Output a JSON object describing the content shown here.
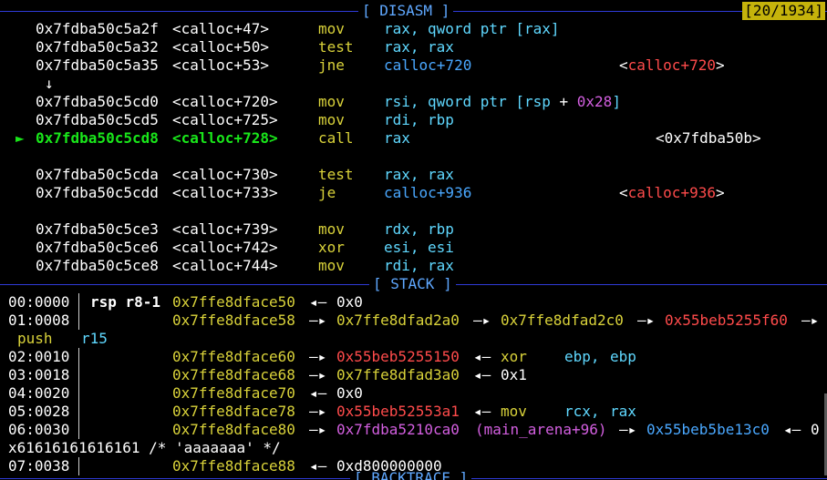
{
  "disasm": {
    "header": "[ DISASM ]",
    "counter": "[20/1934]",
    "rows": [
      {
        "addr": "0x7fdba50c5a2f",
        "sym": "<calloc+47>",
        "op": "mov",
        "a1": "rax,",
        "a2": "qword ptr [rax]",
        "target": ""
      },
      {
        "addr": "0x7fdba50c5a32",
        "sym": "<calloc+50>",
        "op": "test",
        "a1": "rax,",
        "a2": "rax",
        "target": ""
      },
      {
        "addr": "0x7fdba50c5a35",
        "sym": "<calloc+53>",
        "op": "jne",
        "a1": "calloc+720",
        "a2": "",
        "target": "<calloc+720>"
      },
      {
        "addr": "0x7fdba50c5cd0",
        "sym": "<calloc+720>",
        "op": "mov",
        "a1": "rsi,",
        "a2": "qword ptr [rsp + 0x28]",
        "target": ""
      },
      {
        "addr": "0x7fdba50c5cd5",
        "sym": "<calloc+725>",
        "op": "mov",
        "a1": "rdi,",
        "a2": "rbp",
        "target": ""
      },
      {
        "addr": "0x7fdba50c5cd8",
        "sym": "<calloc+728>",
        "op": "call",
        "a1": "rax",
        "a2": "",
        "target": "<0x7fdba50b>"
      },
      {
        "addr": "0x7fdba50c5cda",
        "sym": "<calloc+730>",
        "op": "test",
        "a1": "rax,",
        "a2": "rax",
        "target": ""
      },
      {
        "addr": "0x7fdba50c5cdd",
        "sym": "<calloc+733>",
        "op": "je",
        "a1": "calloc+936",
        "a2": "",
        "target": "<calloc+936>"
      },
      {
        "addr": "0x7fdba50c5ce3",
        "sym": "<calloc+739>",
        "op": "mov",
        "a1": "rdx,",
        "a2": "rbp",
        "target": ""
      },
      {
        "addr": "0x7fdba50c5ce6",
        "sym": "<calloc+742>",
        "op": "xor",
        "a1": "esi,",
        "a2": "esi",
        "target": ""
      },
      {
        "addr": "0x7fdba50c5ce8",
        "sym": "<calloc+744>",
        "op": "mov",
        "a1": "rdi,",
        "a2": "rax",
        "target": ""
      }
    ],
    "jump_arrow": "↓",
    "current_marker": "►",
    "target_prefix": "<",
    "target_sym": "calloc+720",
    "target_suffix": ">"
  },
  "stack": {
    "header": "[ STACK ]",
    "rows": [
      {
        "idx": "00:0000",
        "regs": "rsp r8-1",
        "addr": "0x7ffe8dface50"
      },
      {
        "idx": "01:0008",
        "regs": "",
        "addr": "0x7ffe8dface58"
      },
      {
        "idx": "02:0010",
        "regs": "",
        "addr": "0x7ffe8dface60"
      },
      {
        "idx": "03:0018",
        "regs": "",
        "addr": "0x7ffe8dface68"
      },
      {
        "idx": "04:0020",
        "regs": "",
        "addr": "0x7ffe8dface70"
      },
      {
        "idx": "05:0028",
        "regs": "",
        "addr": "0x7ffe8dface78"
      },
      {
        "idx": "06:0030",
        "regs": "",
        "addr": "0x7ffe8dface80"
      },
      {
        "idx": "07:0038",
        "regs": "",
        "addr": "0x7ffe8dface88"
      }
    ],
    "values": {
      "r0_val": "0x0",
      "r1_p1": "0x7ffe8dfad2a0",
      "r1_p2": "0x7ffe8dfad2c0",
      "r1_p3": "0x55beb5255f60",
      "r1_wrap_op": "push",
      "r1_wrap_arg": "r15",
      "r2_p1": "0x55beb5255150",
      "r2_op": "xor",
      "r2_a1": "ebp,",
      "r2_a2": "ebp",
      "r3_p1": "0x7ffe8dfad3a0",
      "r3_val": "0x1",
      "r4_val": "0x0",
      "r5_p1": "0x55beb52553a1",
      "r5_op": "mov",
      "r5_a1": "rcx,",
      "r5_a2": "rax",
      "r6_p1": "0x7fdba5210ca0",
      "r6_sym": "(main_arena+96)",
      "r6_p2": "0x55beb5be13c0",
      "r6_tail": "0",
      "r6_wrap": "x61616161616161 /* 'aaaaaaa' */",
      "r7_val": "0xd800000000"
    },
    "arrow_right": "—▸",
    "arrow_left": "◂—"
  },
  "backtrace": {
    "header": "[ BACKTRACE ]"
  },
  "colors": {
    "separator": "#2f3bd8",
    "counter_bg": "#c5b30b",
    "current_line": "#19e61a",
    "heap": "#ff4b4b",
    "stack": "#d9d23a",
    "code": "#4aa8ff",
    "libc": "#d35fe0"
  }
}
